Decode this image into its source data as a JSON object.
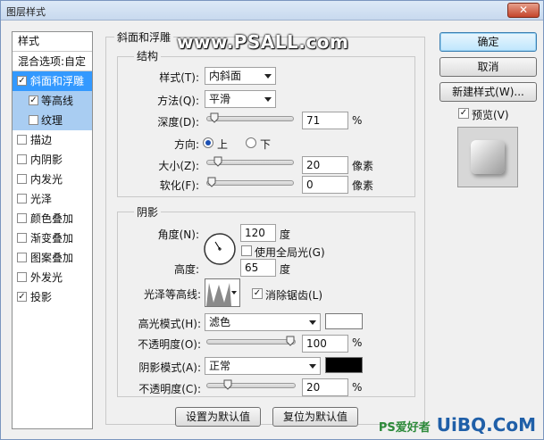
{
  "window": {
    "title": "图层样式",
    "close_glyph": "✕"
  },
  "watermark": {
    "text": "www.PSALL.com",
    "logo_main": "UiBQ.CoM",
    "logo_sub": "PS爱好者"
  },
  "left_panel": {
    "header": "样式",
    "blend_options": "混合选项:自定",
    "items": [
      {
        "label": "斜面和浮雕",
        "checked": true,
        "selected": true,
        "sub": false
      },
      {
        "label": "等高线",
        "checked": true,
        "selected": false,
        "sub": true
      },
      {
        "label": "纹理",
        "checked": false,
        "selected": false,
        "sub": true
      },
      {
        "label": "描边",
        "checked": false,
        "selected": false,
        "sub": false
      },
      {
        "label": "内阴影",
        "checked": false,
        "selected": false,
        "sub": false
      },
      {
        "label": "内发光",
        "checked": false,
        "selected": false,
        "sub": false
      },
      {
        "label": "光泽",
        "checked": false,
        "selected": false,
        "sub": false
      },
      {
        "label": "颜色叠加",
        "checked": false,
        "selected": false,
        "sub": false
      },
      {
        "label": "渐变叠加",
        "checked": false,
        "selected": false,
        "sub": false
      },
      {
        "label": "图案叠加",
        "checked": false,
        "selected": false,
        "sub": false
      },
      {
        "label": "外发光",
        "checked": false,
        "selected": false,
        "sub": false
      },
      {
        "label": "投影",
        "checked": true,
        "selected": false,
        "sub": false
      }
    ]
  },
  "bevel": {
    "title": "斜面和浮雕",
    "structure_title": "结构",
    "style_label": "样式(T):",
    "style_value": "内斜面",
    "method_label": "方法(Q):",
    "method_value": "平滑",
    "depth_label": "深度(D):",
    "depth_value": "71",
    "depth_unit": "%",
    "depth_level": 0.03,
    "direction_label": "方向:",
    "dir_up": "上",
    "dir_down": "下",
    "size_label": "大小(Z):",
    "size_value": "20",
    "size_unit": "像素",
    "size_level": 0.08,
    "soften_label": "软化(F):",
    "soften_value": "0",
    "soften_unit": "像素",
    "soften_level": 0.0
  },
  "shading": {
    "title": "阴影",
    "angle_label": "角度(N):",
    "angle_value": "120",
    "angle_unit": "度",
    "global_light": "使用全局光(G)",
    "altitude_label": "高度:",
    "altitude_value": "65",
    "altitude_unit": "度",
    "gloss_label": "光泽等高线:",
    "antialias": "消除锯齿(L)",
    "highlight_label": "高光模式(H):",
    "highlight_value": "滤色",
    "highlight_color": "#ffffff",
    "opacity1_label": "不透明度(O):",
    "opacity1_value": "100",
    "opacity1_unit": "%",
    "opacity1_level": 1.0,
    "shadow_label": "阴影模式(A):",
    "shadow_value": "正常",
    "shadow_color": "#000000",
    "opacity2_label": "不透明度(C):",
    "opacity2_value": "20",
    "opacity2_unit": "%",
    "opacity2_level": 0.2
  },
  "buttons": {
    "make_default": "设置为默认值",
    "reset_default": "复位为默认值",
    "ok": "确定",
    "cancel": "取消",
    "new_style": "新建样式(W)...",
    "preview": "预览(V)"
  }
}
